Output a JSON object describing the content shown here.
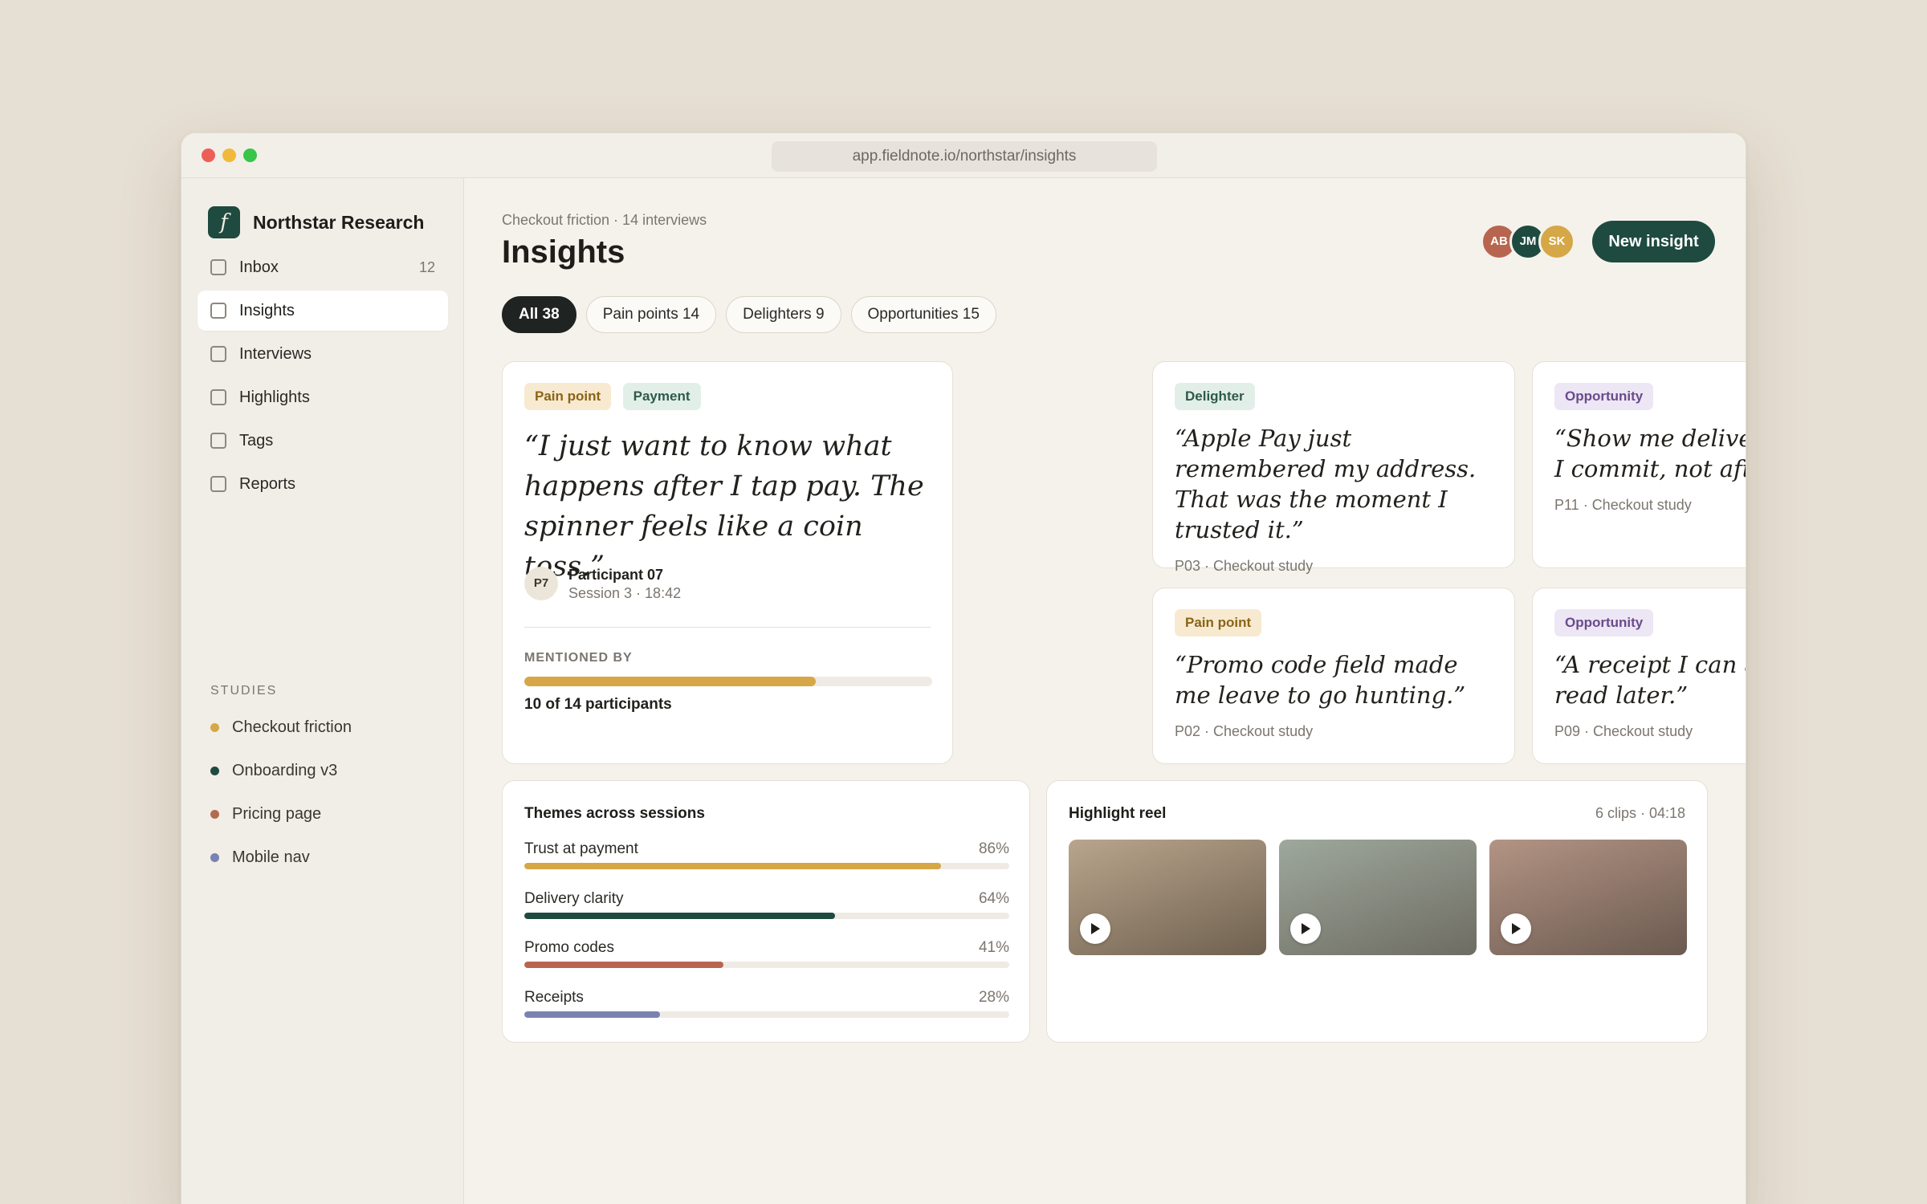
{
  "window": {
    "url": "app.fieldnote.io/northstar/insights"
  },
  "sidebar": {
    "brand": {
      "logo": "f",
      "name": "Northstar Research"
    },
    "items": [
      {
        "label": "Inbox",
        "count": "12",
        "icon": "checkbox-icon"
      },
      {
        "label": "Insights",
        "count": "",
        "icon": "checkbox-icon",
        "active": true
      },
      {
        "label": "Interviews",
        "count": "",
        "icon": "checkbox-icon"
      },
      {
        "label": "Highlights",
        "count": "",
        "icon": "checkbox-icon"
      },
      {
        "label": "Tags",
        "count": "",
        "icon": "checkbox-icon"
      },
      {
        "label": "Reports",
        "count": "",
        "icon": "checkbox-icon"
      }
    ],
    "studies_heading": "STUDIES",
    "studies": [
      {
        "label": "Checkout friction",
        "color": "#d6a747"
      },
      {
        "label": "Onboarding v3",
        "color": "#1f4a3f"
      },
      {
        "label": "Pricing page",
        "color": "#b46a50"
      },
      {
        "label": "Mobile nav",
        "color": "#7a82b0"
      }
    ]
  },
  "header": {
    "breadcrumb": "Checkout friction · 14 interviews",
    "title": "Insights",
    "avatars": [
      {
        "initials": "AB",
        "color": "#b8654f"
      },
      {
        "initials": "JM",
        "color": "#1f4a3f"
      },
      {
        "initials": "SK",
        "color": "#d6a747"
      }
    ],
    "new_button": "New insight"
  },
  "filters": [
    "All 38",
    "Pain points 14",
    "Delighters 9",
    "Opportunities 15"
  ],
  "featured": {
    "tags": [
      "Pain point",
      "Payment"
    ],
    "quote": "“I just want to know what happens after I tap pay. The spinner feels like a coin toss.”",
    "participant_initials": "P7",
    "participant_name": "Participant 07",
    "session": "Session 3 · 18:42",
    "mentioned_heading": "MENTIONED BY",
    "mentioned_fraction": 0.714,
    "mentioned_text": "10 of 14 participants"
  },
  "cards": [
    {
      "tag": "Delighter",
      "quote": "“Apple Pay just remembered my address. That was the moment I trusted it.”",
      "meta": "P03 · Checkout study"
    },
    {
      "tag": "Opportunity",
      "quote": "“Show me delivery before I commit, not after.”",
      "meta": "P11 · Checkout study"
    },
    {
      "tag": "Pain point",
      "quote": "“Promo code field made me leave to go hunting.”",
      "meta": "P02 · Checkout study"
    },
    {
      "tag": "Opportunity",
      "quote": "“A receipt I can actually read later.”",
      "meta": "P09 · Checkout study"
    }
  ],
  "themes": {
    "title": "Themes across sessions",
    "rows": [
      {
        "label": "Trust at payment",
        "pct": "86%",
        "value": 86,
        "color": "#d6a747"
      },
      {
        "label": "Delivery clarity",
        "pct": "64%",
        "value": 64,
        "color": "#1f4a3f"
      },
      {
        "label": "Promo codes",
        "pct": "41%",
        "value": 41,
        "color": "#b8654f"
      },
      {
        "label": "Receipts",
        "pct": "28%",
        "value": 28,
        "color": "#7a82b0"
      }
    ]
  },
  "reel": {
    "title": "Highlight reel",
    "meta": "6 clips · 04:18",
    "clips": [
      {
        "icon": "play-icon",
        "colors": [
          "#b9a58c",
          "#6f6150"
        ]
      },
      {
        "icon": "play-icon",
        "colors": [
          "#9ea89c",
          "#6e6c62"
        ]
      },
      {
        "icon": "play-icon",
        "colors": [
          "#b39484",
          "#6b5a50"
        ]
      }
    ]
  }
}
